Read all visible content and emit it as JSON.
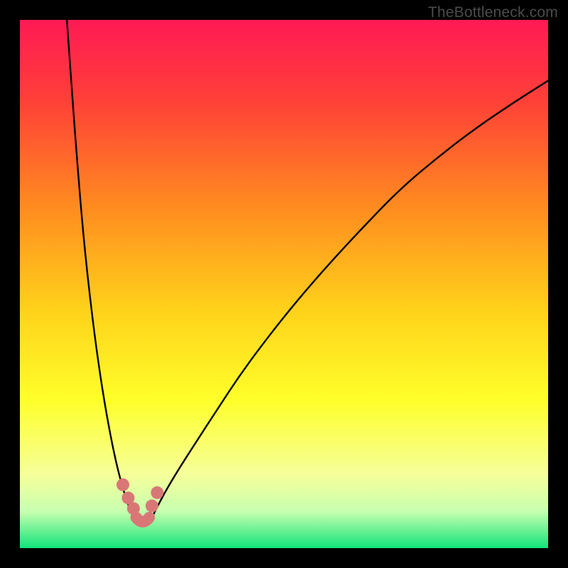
{
  "watermark": "TheBottleneck.com",
  "chart_data": {
    "type": "line",
    "title": "",
    "xlabel": "",
    "ylabel": "",
    "xlim": [
      0,
      100
    ],
    "ylim": [
      0,
      100
    ],
    "gradient_stops": [
      {
        "offset": 0.0,
        "color": "#ff1a55"
      },
      {
        "offset": 0.15,
        "color": "#ff3f38"
      },
      {
        "offset": 0.35,
        "color": "#ff8a20"
      },
      {
        "offset": 0.55,
        "color": "#ffd21a"
      },
      {
        "offset": 0.72,
        "color": "#ffff2a"
      },
      {
        "offset": 0.86,
        "color": "#f6ff9a"
      },
      {
        "offset": 0.93,
        "color": "#c8ffb0"
      },
      {
        "offset": 1.0,
        "color": "#12e47a"
      }
    ],
    "series": [
      {
        "name": "left-curve",
        "x": [
          8.9,
          9.6,
          10.7,
          12.1,
          13.9,
          15.6,
          17.2,
          18.5,
          19.6,
          20.4,
          21.0,
          21.5,
          21.9,
          22.0
        ],
        "y": [
          0.0,
          10.0,
          25.0,
          42.0,
          58.0,
          70.0,
          79.0,
          85.0,
          89.0,
          91.5,
          93.0,
          94.0,
          94.5,
          95.0
        ]
      },
      {
        "name": "right-curve",
        "x": [
          24.5,
          25.1,
          26.1,
          27.7,
          30.1,
          33.3,
          37.2,
          41.8,
          47.0,
          52.6,
          58.7,
          65.2,
          72.0,
          79.1,
          86.3,
          93.7,
          100.0
        ],
        "y": [
          95.0,
          94.0,
          92.0,
          89.0,
          85.0,
          80.0,
          74.0,
          67.0,
          60.0,
          53.0,
          46.0,
          39.0,
          32.0,
          26.0,
          20.5,
          15.5,
          11.5
        ]
      }
    ],
    "points": [
      {
        "series": "left-curve",
        "x": 19.5,
        "y": 88.0
      },
      {
        "series": "left-curve",
        "x": 20.5,
        "y": 90.5
      },
      {
        "series": "left-curve",
        "x": 21.5,
        "y": 92.5
      },
      {
        "series": "right-curve",
        "x": 25.0,
        "y": 92.0
      },
      {
        "series": "right-curve",
        "x": 26.0,
        "y": 89.5
      }
    ],
    "minimum_band": {
      "x_start": 22.0,
      "x_end": 24.5,
      "y": 95.0
    },
    "colors": {
      "curve": "#000000",
      "point": "#d97777",
      "background_top": "#ff1a55",
      "background_bottom": "#12e47a"
    }
  }
}
